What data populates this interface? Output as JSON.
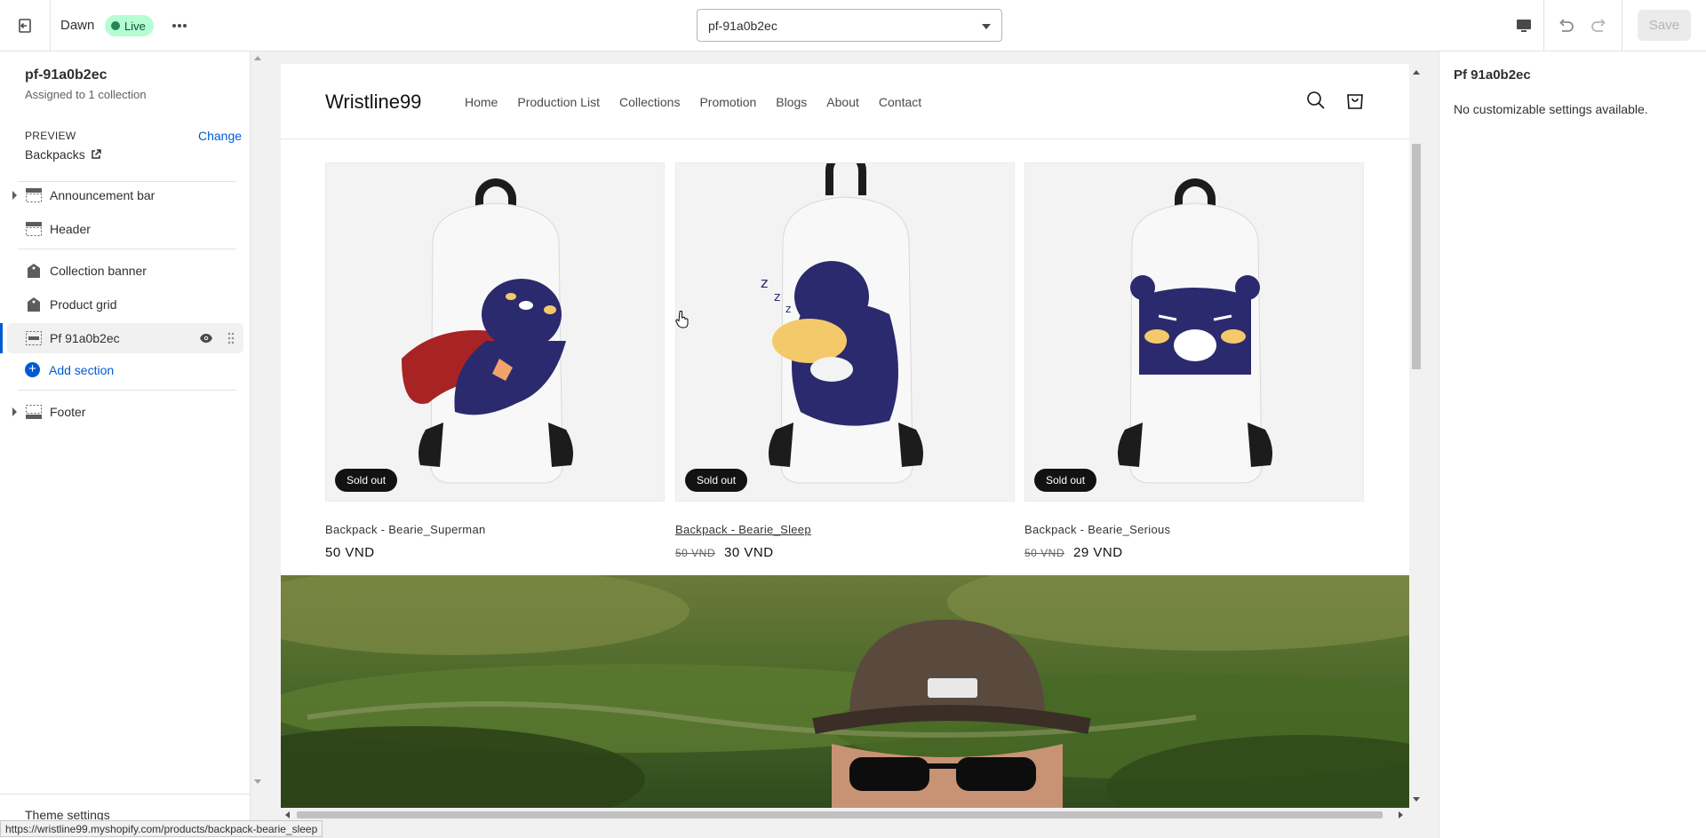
{
  "topbar": {
    "theme_name": "Dawn",
    "live_label": "Live",
    "template_select": "pf-91a0b2ec",
    "save_label": "Save"
  },
  "sidebar": {
    "page_title": "pf-91a0b2ec",
    "page_subtitle": "Assigned to 1 collection",
    "preview_label": "PREVIEW",
    "change_label": "Change",
    "preview_value": "Backpacks",
    "sections": [
      {
        "label": "Announcement bar",
        "icon": "announcement-icon",
        "expandable": true
      },
      {
        "label": "Header",
        "icon": "header-icon",
        "expandable": false
      },
      {
        "label": "Collection banner",
        "icon": "collection-icon",
        "expandable": false
      },
      {
        "label": "Product grid",
        "icon": "collection-icon",
        "expandable": false
      },
      {
        "label": "Pf 91a0b2ec",
        "icon": "section-icon",
        "expandable": false,
        "active": true
      },
      {
        "label": "Footer",
        "icon": "footer-icon",
        "expandable": true
      }
    ],
    "add_section_label": "Add section",
    "theme_settings_label": "Theme settings"
  },
  "store": {
    "logo": "Wristline99",
    "nav": [
      "Home",
      "Production List",
      "Collections",
      "Promotion",
      "Blogs",
      "About",
      "Contact"
    ],
    "products": [
      {
        "title": "Backpack - Bearie_Superman",
        "price": "50 VND",
        "compare_price": "",
        "badge": "Sold out"
      },
      {
        "title": "Backpack - Bearie_Sleep",
        "price": "30 VND",
        "compare_price": "50 VND",
        "badge": "Sold out"
      },
      {
        "title": "Backpack - Bearie_Serious",
        "price": "29 VND",
        "compare_price": "50 VND",
        "badge": "Sold out"
      }
    ]
  },
  "right_panel": {
    "title": "Pf 91a0b2ec",
    "text": "No customizable settings available."
  },
  "status_bar": {
    "url": "https://wristline99.myshopify.com/products/backpack-bearie_sleep"
  },
  "colors": {
    "accent": "#005bd3",
    "live_badge": "#b4fed2",
    "bear": "#2c2a6e"
  }
}
